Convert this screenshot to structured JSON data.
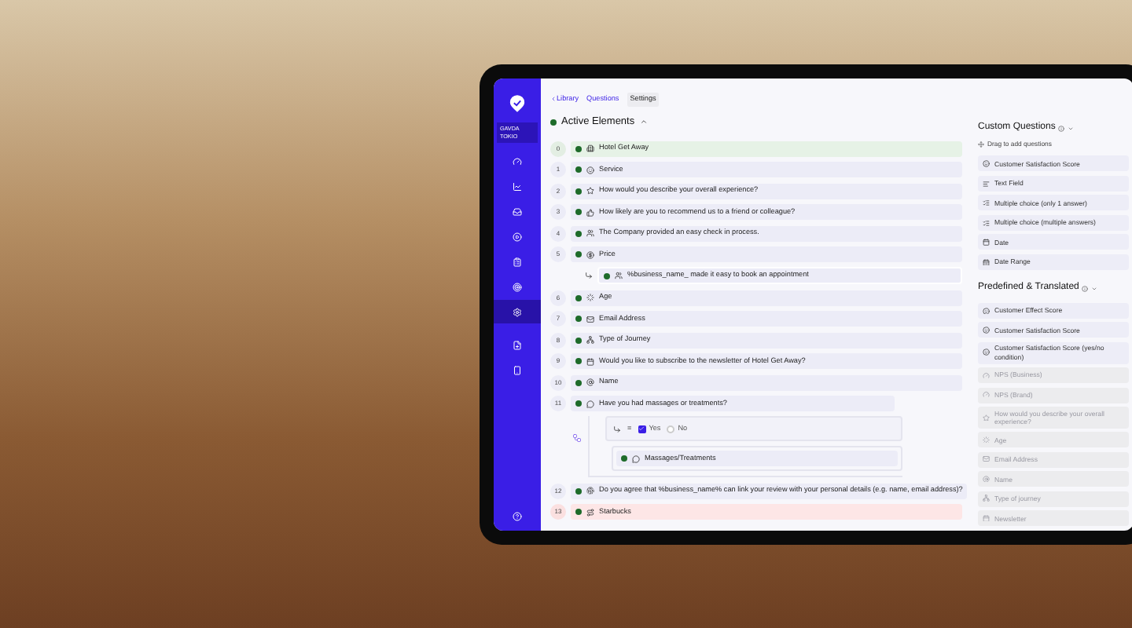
{
  "sidebar": {
    "workspace": "GAVDA TOKIO",
    "nav_items": [
      {
        "selected": false
      },
      {
        "selected": false
      },
      {
        "selected": false
      },
      {
        "selected": false
      },
      {
        "selected": false
      },
      {
        "selected": false
      },
      {
        "selected": true
      },
      {
        "selected": false
      },
      {
        "selected": false
      }
    ]
  },
  "breadcrumb": {
    "back": "Library",
    "tabs": [
      {
        "label": "Questions",
        "selected": false
      },
      {
        "label": "Settings",
        "selected": true
      }
    ]
  },
  "section": {
    "title": "Active Elements",
    "expanded": true
  },
  "elements": [
    {
      "number": "0",
      "label": "Hotel Get Away",
      "kind": "header"
    },
    {
      "number": "1",
      "label": "Service",
      "kind": "question"
    },
    {
      "number": "2",
      "label": "How would you describe your overall experience?",
      "kind": "question"
    },
    {
      "number": "3",
      "label": "How likely are you to recommend us to a friend or colleague?",
      "kind": "question"
    },
    {
      "number": "4",
      "label": "The Company provided an easy check in process.",
      "kind": "question"
    },
    {
      "number": "5",
      "label": "Price",
      "kind": "question",
      "children": [
        {
          "label": "%business_name_ made it easy to book an appointment"
        }
      ]
    },
    {
      "number": "6",
      "label": "Age",
      "kind": "question"
    },
    {
      "number": "7",
      "label": "Email Address",
      "kind": "question"
    },
    {
      "number": "8",
      "label": "Type of Journey",
      "kind": "question"
    },
    {
      "number": "9",
      "label": "Would you like to subscribe to the newsletter of Hotel Get Away?",
      "kind": "question"
    },
    {
      "number": "10",
      "label": "Name",
      "kind": "question"
    },
    {
      "number": "11",
      "label": "Have you had massages or treatments?",
      "kind": "question",
      "condition": {
        "operator": "=",
        "options": [
          {
            "label": "Yes",
            "checked": true
          },
          {
            "label": "No",
            "checked": false
          }
        ],
        "children": [
          {
            "label": "Massages/Treatments"
          }
        ]
      }
    },
    {
      "number": "12",
      "label": "Do you agree that %business_name% can link your review with your personal details (e.g. name, email address)?",
      "kind": "question"
    },
    {
      "number": "13",
      "label": "Starbucks",
      "kind": "error"
    }
  ],
  "custom_questions": {
    "title": "Custom Questions",
    "hint": "Drag to add questions",
    "items": [
      {
        "label": "Customer Satisfaction Score"
      },
      {
        "label": "Text Field"
      },
      {
        "label": "Multiple choice (only 1 answer)"
      },
      {
        "label": "Multiple choice (multiple answers)"
      },
      {
        "label": "Date"
      },
      {
        "label": "Date Range"
      }
    ]
  },
  "predefined": {
    "title": "Predefined & Translated",
    "items": [
      {
        "label": "Customer Effect Score",
        "disabled": false
      },
      {
        "label": "Customer Satisfaction Score",
        "disabled": false
      },
      {
        "label": "Customer Satisfaction Score (yes/no condition)",
        "disabled": false
      },
      {
        "label": "NPS (Business)",
        "disabled": true
      },
      {
        "label": "NPS (Brand)",
        "disabled": true
      },
      {
        "label": "How would you describe your overall experience?",
        "disabled": true
      },
      {
        "label": "Age",
        "disabled": true
      },
      {
        "label": "Email Address",
        "disabled": true
      },
      {
        "label": "Name",
        "disabled": true
      },
      {
        "label": "Type of journey",
        "disabled": true
      },
      {
        "label": "Newsletter",
        "disabled": true
      }
    ]
  }
}
